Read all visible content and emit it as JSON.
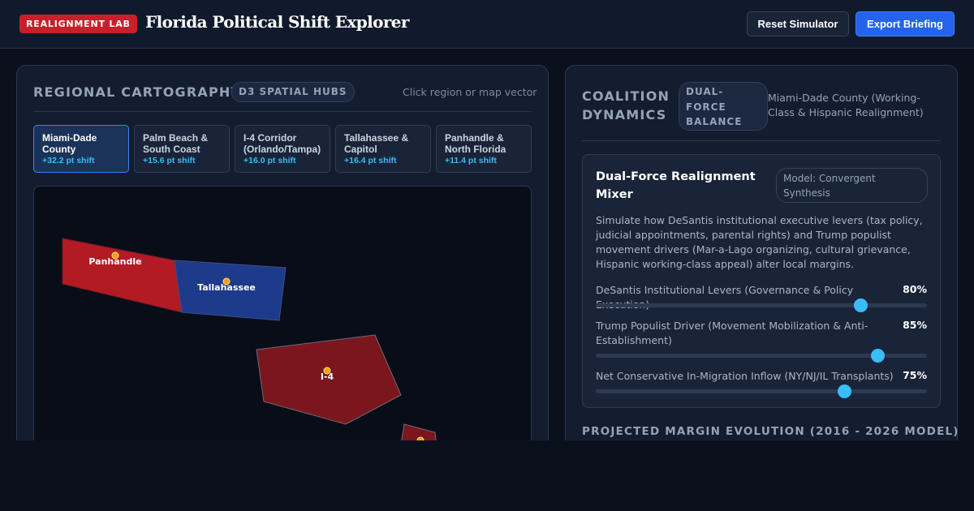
{
  "header": {
    "badge": "REALIGNMENT LAB",
    "title": "Florida Political Shift Explorer",
    "reset_label": "Reset Simulator",
    "export_label": "Export Briefing"
  },
  "cartography": {
    "title": "REGIONAL CARTOGRAPHY",
    "pill": "D3 SPATIAL HUBS",
    "hint": "Click region or map vector",
    "tabs": [
      {
        "name": "Miami-Dade County",
        "shift": "+32.2 pt shift",
        "active": true
      },
      {
        "name": "Palm Beach & South Coast",
        "shift": "+15.6 pt shift",
        "active": false
      },
      {
        "name": "I-4 Corridor (Orlando/Tampa)",
        "shift": "+16.0 pt shift",
        "active": false
      },
      {
        "name": "Tallahassee & Capitol",
        "shift": "+16.4 pt shift",
        "active": false
      },
      {
        "name": "Panhandle & North Florida",
        "shift": "+11.4 pt shift",
        "active": false
      }
    ],
    "map_labels": {
      "panhandle": "Panhandle",
      "tallahassee": "Tallahassee",
      "i4": "I-4"
    },
    "colors": {
      "republican": "#b31b24",
      "democratic": "#1e3a8a",
      "dark_red": "#7c161d",
      "marker": "#f59e0b"
    }
  },
  "coalition": {
    "title_line1": "COALITION",
    "title_line2": "DYNAMICS",
    "pill_line1": "DUAL-",
    "pill_line2": "FORCE",
    "pill_line3": "BALANCE",
    "context": "Miami-Dade County (Working-Class & Hispanic Realignment)",
    "mixer": {
      "title": "Dual-Force Realignment Mixer",
      "model": "Model: Convergent Synthesis",
      "description": "Simulate how DeSantis institutional executive levers (tax policy, judicial appointments, parental rights) and Trump populist movement drivers (Mar-a-Lago organizing, cultural grievance, Hispanic working-class appeal) alter local margins.",
      "sliders": [
        {
          "label": "DeSantis Institutional Levers (Governance & Policy Execution)",
          "value_text": "80%",
          "value": 80
        },
        {
          "label": "Trump Populist Driver (Movement Mobilization & Anti-Establishment)",
          "value_text": "85%",
          "value": 85
        },
        {
          "label": "Net Conservative In-Migration Inflow (NY/NJ/IL Transplants)",
          "value_text": "75%",
          "value": 75
        }
      ]
    },
    "projection_title": "PROJECTED MARGIN EVOLUTION (2016 - 2026 MODEL)"
  }
}
